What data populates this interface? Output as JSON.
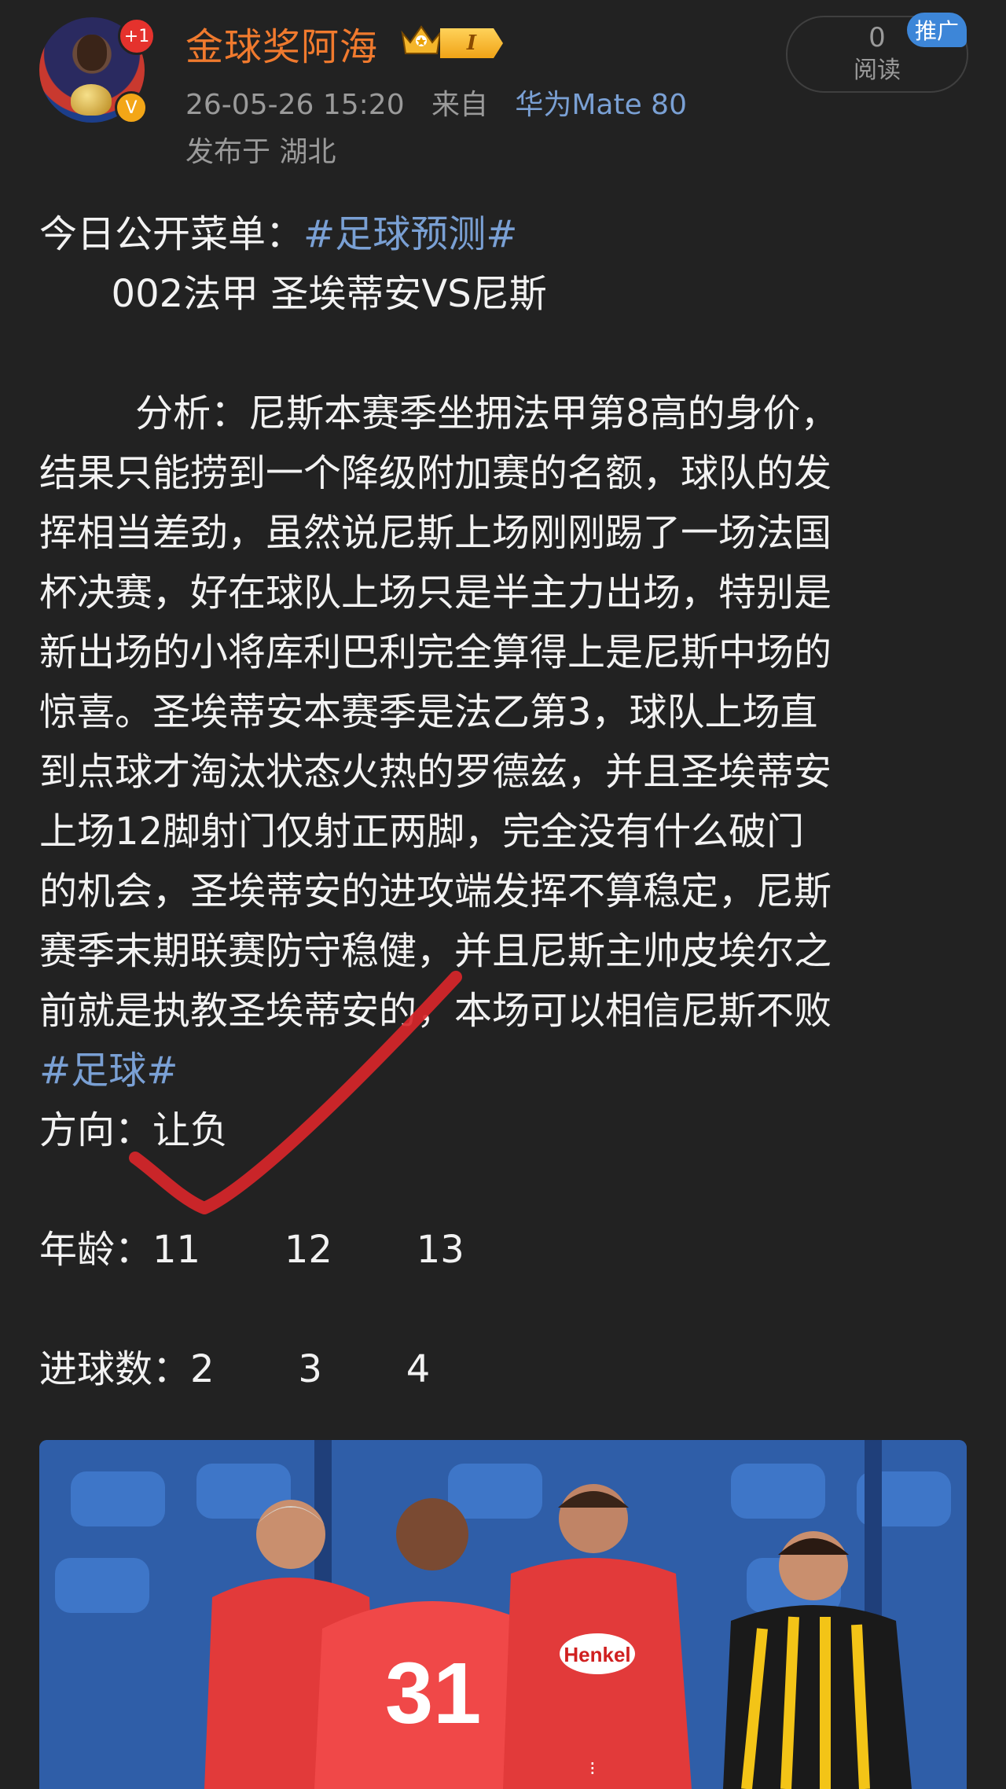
{
  "author": {
    "name": "金球奖阿海",
    "notification_badge": "+1",
    "verified_mark": "V",
    "level_badge": "I",
    "timestamp": "26-05-26 15:20",
    "via_label": "来自",
    "device": "华为Mate 80",
    "location_line": "发布于 湖北"
  },
  "read_counter": {
    "count": "0",
    "label": "阅读",
    "promo_tag": "推广"
  },
  "post": {
    "title_prefix": "今日公开菜单：",
    "title_hashtag": "#足球预测#",
    "match_line": "      002法甲 圣埃蒂安VS尼斯",
    "analysis_lines": [
      "        分析：尼斯本赛季坐拥法甲第8高的身价，",
      "结果只能捞到一个降级附加赛的名额，球队的发",
      "挥相当差劲，虽然说尼斯上场刚刚踢了一场法国",
      "杯决赛，好在球队上场只是半主力出场，特别是",
      "新出场的小将库利巴利完全算得上是尼斯中场的",
      "惊喜。圣埃蒂安本赛季是法乙第3，球队上场直",
      "到点球才淘汰状态火热的罗德兹，并且圣埃蒂安",
      "上场12脚射门仅射正两脚，完全没有什么破门",
      "的机会，圣埃蒂安的进攻端发挥不算稳定，尼斯",
      "赛季末期联赛防守稳健，并且尼斯主帅皮埃尔之",
      "前就是执教圣埃蒂安的，本场可以相信尼斯不败"
    ],
    "hashtag_football": "#足球#",
    "direction_line": "方向：让负",
    "age_line": "年龄：11       12       13",
    "goals_line": "进球数：2       3       4"
  },
  "image": {
    "jersey_number": "31",
    "sponsor": "Henkel"
  },
  "colors": {
    "background": "#222222",
    "username": "#f07a2e",
    "hashtag": "#7aa0d4",
    "check_mark": "#d8262a"
  }
}
